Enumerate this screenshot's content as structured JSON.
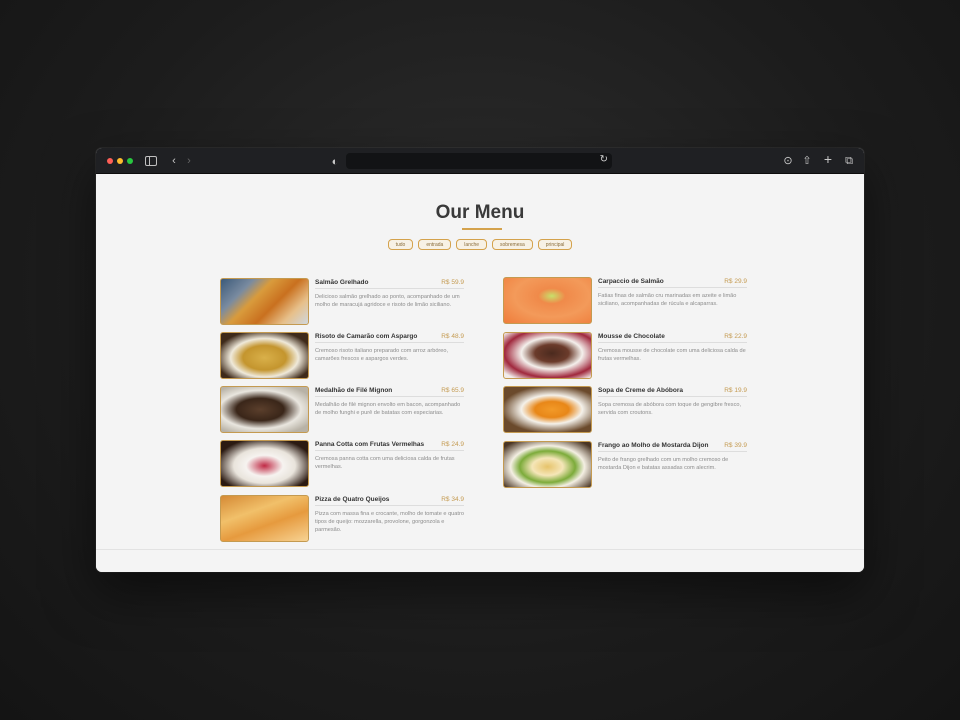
{
  "browser": {
    "icons": [
      "sidebar-icon",
      "back-icon",
      "forward-icon",
      "shield-icon",
      "reload-icon",
      "download-icon",
      "share-icon",
      "new-tab-icon",
      "tabs-overview-icon"
    ]
  },
  "menu": {
    "title": "Our Menu",
    "filters": [
      "tudo",
      "entrada",
      "lanche",
      "sobremesa",
      "principal"
    ],
    "left_items": [
      {
        "name": "Salmão Grelhado",
        "price": "R$ 59.9",
        "desc": "Delicioso salmão grelhado ao ponto, acompanhado de um molho de maracujá agridoce e risoto de limão siciliano.",
        "image": "salmon-dish"
      },
      {
        "name": "Risoto de Camarão com Aspargo",
        "price": "R$ 48.9",
        "desc": "Cremoso risoto italiano preparado com arroz arbóreo, camarões frescos e aspargos verdes.",
        "image": "risotto-dish"
      },
      {
        "name": "Medalhão de Filé Mignon",
        "price": "R$ 65.9",
        "desc": "Medalhão de filé mignon envolto em bacon, acompanhado de molho funghi e purê de batatas com especiarias.",
        "image": "medallion-dish"
      },
      {
        "name": "Panna Cotta com Frutas Vermelhas",
        "price": "R$ 24.9",
        "desc": "Cremosa panna cotta com uma deliciosa calda de frutas vermelhas.",
        "image": "panna-cotta-dish"
      },
      {
        "name": "Pizza de Quatro Queijos",
        "price": "R$ 34.9",
        "desc": "Pizza com massa fina e crocante, molho de tomate e quatro tipos de queijo: mozzarella, provolone, gorgonzola e parmesão.",
        "image": "pizza-dish"
      }
    ],
    "right_items": [
      {
        "name": "Carpaccio de Salmão",
        "price": "R$ 29.9",
        "desc": "Fatias finas de salmão cru marinadas em azeite e limão siciliano, acompanhadas de rúcula e alcaparras.",
        "image": "carpaccio-dish"
      },
      {
        "name": "Mousse de Chocolate",
        "price": "R$ 22.9",
        "desc": "Cremosa mousse de chocolate com uma deliciosa calda de frutas vermelhas.",
        "image": "mousse-dish"
      },
      {
        "name": "Sopa de Creme de Abóbora",
        "price": "R$ 19.9",
        "desc": "Sopa cremosa de abóbora com toque de gengibre fresco, servida com croutons.",
        "image": "pumpkin-soup-dish"
      },
      {
        "name": "Frango ao Molho de Mostarda Dijon",
        "price": "R$ 39.9",
        "desc": "Peito de frango grelhado com um molho cremoso de mostarda Dijon e batatas assadas com alecrim.",
        "image": "chicken-dish"
      }
    ]
  },
  "colors": {
    "accent": "#d4a24c",
    "title": "#3a3a3a",
    "text": "#8c8c8c"
  }
}
